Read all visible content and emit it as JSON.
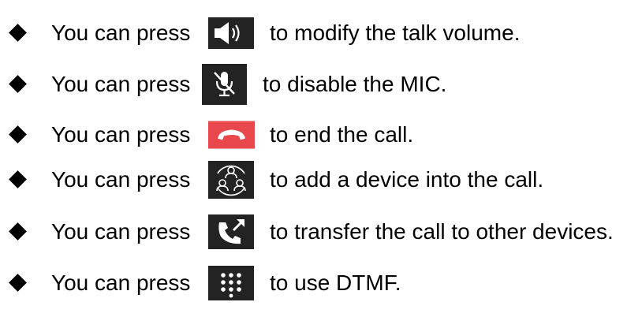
{
  "items": [
    {
      "prefix": "You can press",
      "icon": "speaker-volume-icon",
      "suffix": "to modify the talk volume."
    },
    {
      "prefix": "You can press",
      "icon": "mic-mute-icon",
      "suffix": "to disable the MIC."
    },
    {
      "prefix": "You can press",
      "icon": "end-call-icon",
      "suffix": "to end the call."
    },
    {
      "prefix": "You can press",
      "icon": "add-device-conference-icon",
      "suffix": "to add a device into the call."
    },
    {
      "prefix": "You can press",
      "icon": "transfer-call-icon",
      "suffix": "to transfer the call to other devices."
    },
    {
      "prefix": "You can press",
      "icon": "dtmf-keypad-icon",
      "suffix": "to use DTMF."
    }
  ],
  "colors": {
    "text": "#000000",
    "icon_dark": "#232323",
    "icon_red": "#e8474b",
    "icon_glyph": "#ffffff"
  }
}
